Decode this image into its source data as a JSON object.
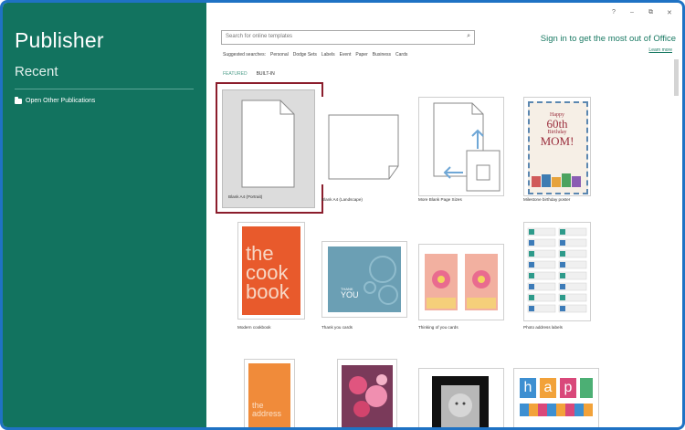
{
  "sidebar": {
    "app_title": "Publisher",
    "recent_label": "Recent",
    "open_other": "Open Other Publications"
  },
  "window_controls": {
    "help": "?",
    "minimize": "–",
    "restore": "⧉",
    "close": "✕"
  },
  "search": {
    "placeholder": "Search for online templates"
  },
  "suggested": {
    "label": "Suggested searches:",
    "items": [
      "Personal",
      "Dodge Sets",
      "Labels",
      "Event",
      "Paper",
      "Business",
      "Cards"
    ]
  },
  "tabs": {
    "featured": "FEATURED",
    "built_in": "BUILT-IN"
  },
  "signin": {
    "text": "Sign in to get the most out of Office",
    "learn": "Learn more"
  },
  "templates": [
    {
      "label": "Blank A4 (Portrait)"
    },
    {
      "label": "Blank A4 (Landscape)"
    },
    {
      "label": "More Blank Page Sizes"
    },
    {
      "label": "Milestone birthday poster",
      "text_lines": [
        "Happy",
        "60th",
        "Birthday",
        "MOM!"
      ]
    },
    {
      "label": "Modern cookbook",
      "text_lines": [
        "the",
        "cook",
        "book"
      ]
    },
    {
      "label": "Thank you cards",
      "text_lines": [
        "THANK",
        "YOU"
      ]
    },
    {
      "label": "Thinking of you cards"
    },
    {
      "label": "Photo address labels"
    },
    {
      "label": "",
      "text_lines": [
        "the",
        "address"
      ]
    },
    {
      "label": ""
    },
    {
      "label": ""
    },
    {
      "label": "",
      "text_lines": [
        "h",
        "a",
        "p"
      ]
    }
  ],
  "colors": {
    "sidebar": "#12735f",
    "accent": "#1b7a64",
    "selection": "#8b1d2c",
    "frame": "#1f72c4"
  }
}
